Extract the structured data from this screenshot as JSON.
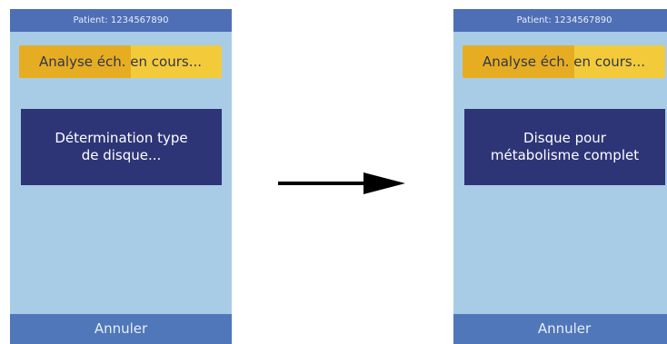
{
  "left_screen": {
    "patient_label": "Patient: 1234567890",
    "progress_label": "Analyse éch. en cours...",
    "progress_fraction": 0.55,
    "message": "Détermination type\nde disque...",
    "cancel_label": "Annuler"
  },
  "right_screen": {
    "patient_label": "Patient: 1234567890",
    "progress_label": "Analyse éch. en cours...",
    "progress_fraction": 0.55,
    "message": "Disque pour\nmétabolisme complet",
    "cancel_label": "Annuler"
  },
  "colors": {
    "screen_background": "#a9cce6",
    "header": "#4e6fb6",
    "progress_track": "#f3cb3a",
    "progress_fill": "#e6ad22",
    "message_box": "#2e3577",
    "cancel_bar": "#5077b9",
    "arrow": "#000000"
  },
  "icons": {
    "transition": "arrow-right-icon"
  }
}
